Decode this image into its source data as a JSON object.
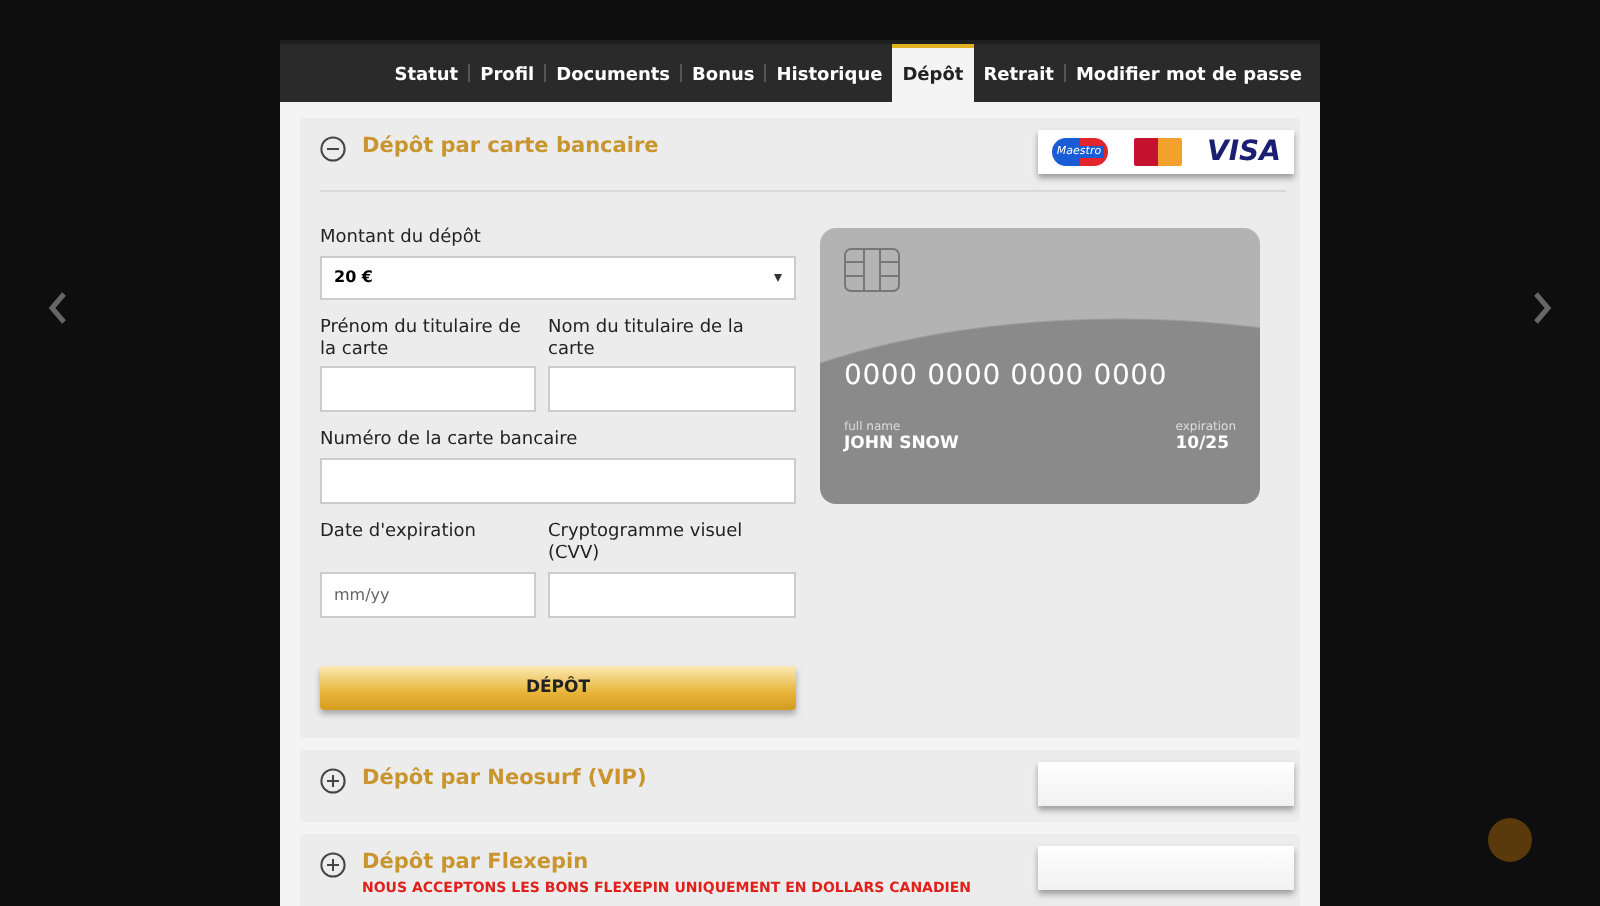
{
  "tabs": [
    {
      "label": "Statut",
      "selected": false
    },
    {
      "label": "Profil",
      "selected": false
    },
    {
      "label": "Documents",
      "selected": false
    },
    {
      "label": "Bonus",
      "selected": false
    },
    {
      "label": "Historique",
      "selected": false
    },
    {
      "label": "Dépôt",
      "selected": true
    },
    {
      "label": "Retrait",
      "selected": false
    },
    {
      "label": "Modifier mot de passe",
      "selected": false
    }
  ],
  "sections": [
    {
      "title": "Dépôt par carte bancaire",
      "expanded": true
    },
    {
      "title": "Dépôt par Neosurf (VIP)",
      "expanded": false
    },
    {
      "title": "Dépôt par Flexepin",
      "expanded": false,
      "note": "NOUS ACCEPTONS LES BONS FLEXEPIN UNIQUEMENT EN DOLLARS CANADIEN"
    }
  ],
  "payment_logos": [
    {
      "kind": "maestro",
      "label": "Maestro"
    },
    {
      "kind": "mastercard"
    },
    {
      "kind": "visa",
      "label": "VISA"
    }
  ],
  "card_form": {
    "fields": [
      {
        "kind": "select",
        "label": "Montant du dépôt",
        "value": "20 €",
        "full_width": true
      },
      {
        "kind": "text",
        "label": "Prénom du titulaire de la carte",
        "full_width": false
      },
      {
        "kind": "text",
        "label": "Nom du titulaire de la carte",
        "full_width": false
      },
      {
        "kind": "text",
        "label": "Numéro de la carte bancaire",
        "full_width": true
      },
      {
        "kind": "text",
        "label": "Date d'expiration",
        "placeholder": "mm/yy",
        "full_width": false
      },
      {
        "kind": "text",
        "label": "Cryptogramme visuel (CVV)",
        "full_width": false
      }
    ],
    "submit": "DÉPÔT"
  },
  "card_preview": {
    "number": "0000 0000 0000 0000",
    "name_label": "full name",
    "name": "JOHN SNOW",
    "expiry_label": "expiration",
    "expiry": "10/25"
  }
}
